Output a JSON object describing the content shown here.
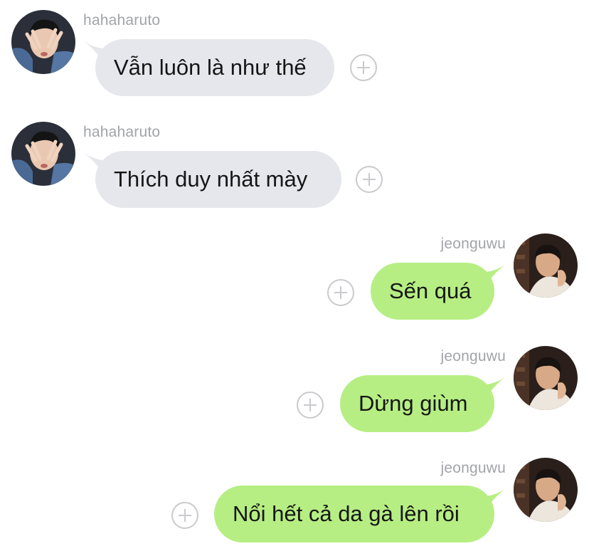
{
  "colors": {
    "incoming_bubble": "#e5e7ec",
    "outgoing_bubble": "#b6ee83",
    "username": "#a2a4a8",
    "text": "#161616"
  },
  "messages": [
    {
      "sender": "hahaharuto",
      "direction": "incoming",
      "text": "Vẫn luôn là như thế",
      "avatar": "avatar-haruto-icon",
      "action": "add-reaction-icon"
    },
    {
      "sender": "hahaharuto",
      "direction": "incoming",
      "text": "Thích duy nhất mày",
      "avatar": "avatar-haruto-icon",
      "action": "add-reaction-icon"
    },
    {
      "sender": "jeonguwu",
      "direction": "outgoing",
      "text": "Sến quá",
      "avatar": "avatar-jeonguwu-icon",
      "action": "add-reaction-icon"
    },
    {
      "sender": "jeonguwu",
      "direction": "outgoing",
      "text": "Dừng giùm",
      "avatar": "avatar-jeonguwu-icon",
      "action": "add-reaction-icon"
    },
    {
      "sender": "jeonguwu",
      "direction": "outgoing",
      "text": "Nổi hết cả da gà lên rồi",
      "avatar": "avatar-jeonguwu-icon",
      "action": "add-reaction-icon"
    }
  ]
}
